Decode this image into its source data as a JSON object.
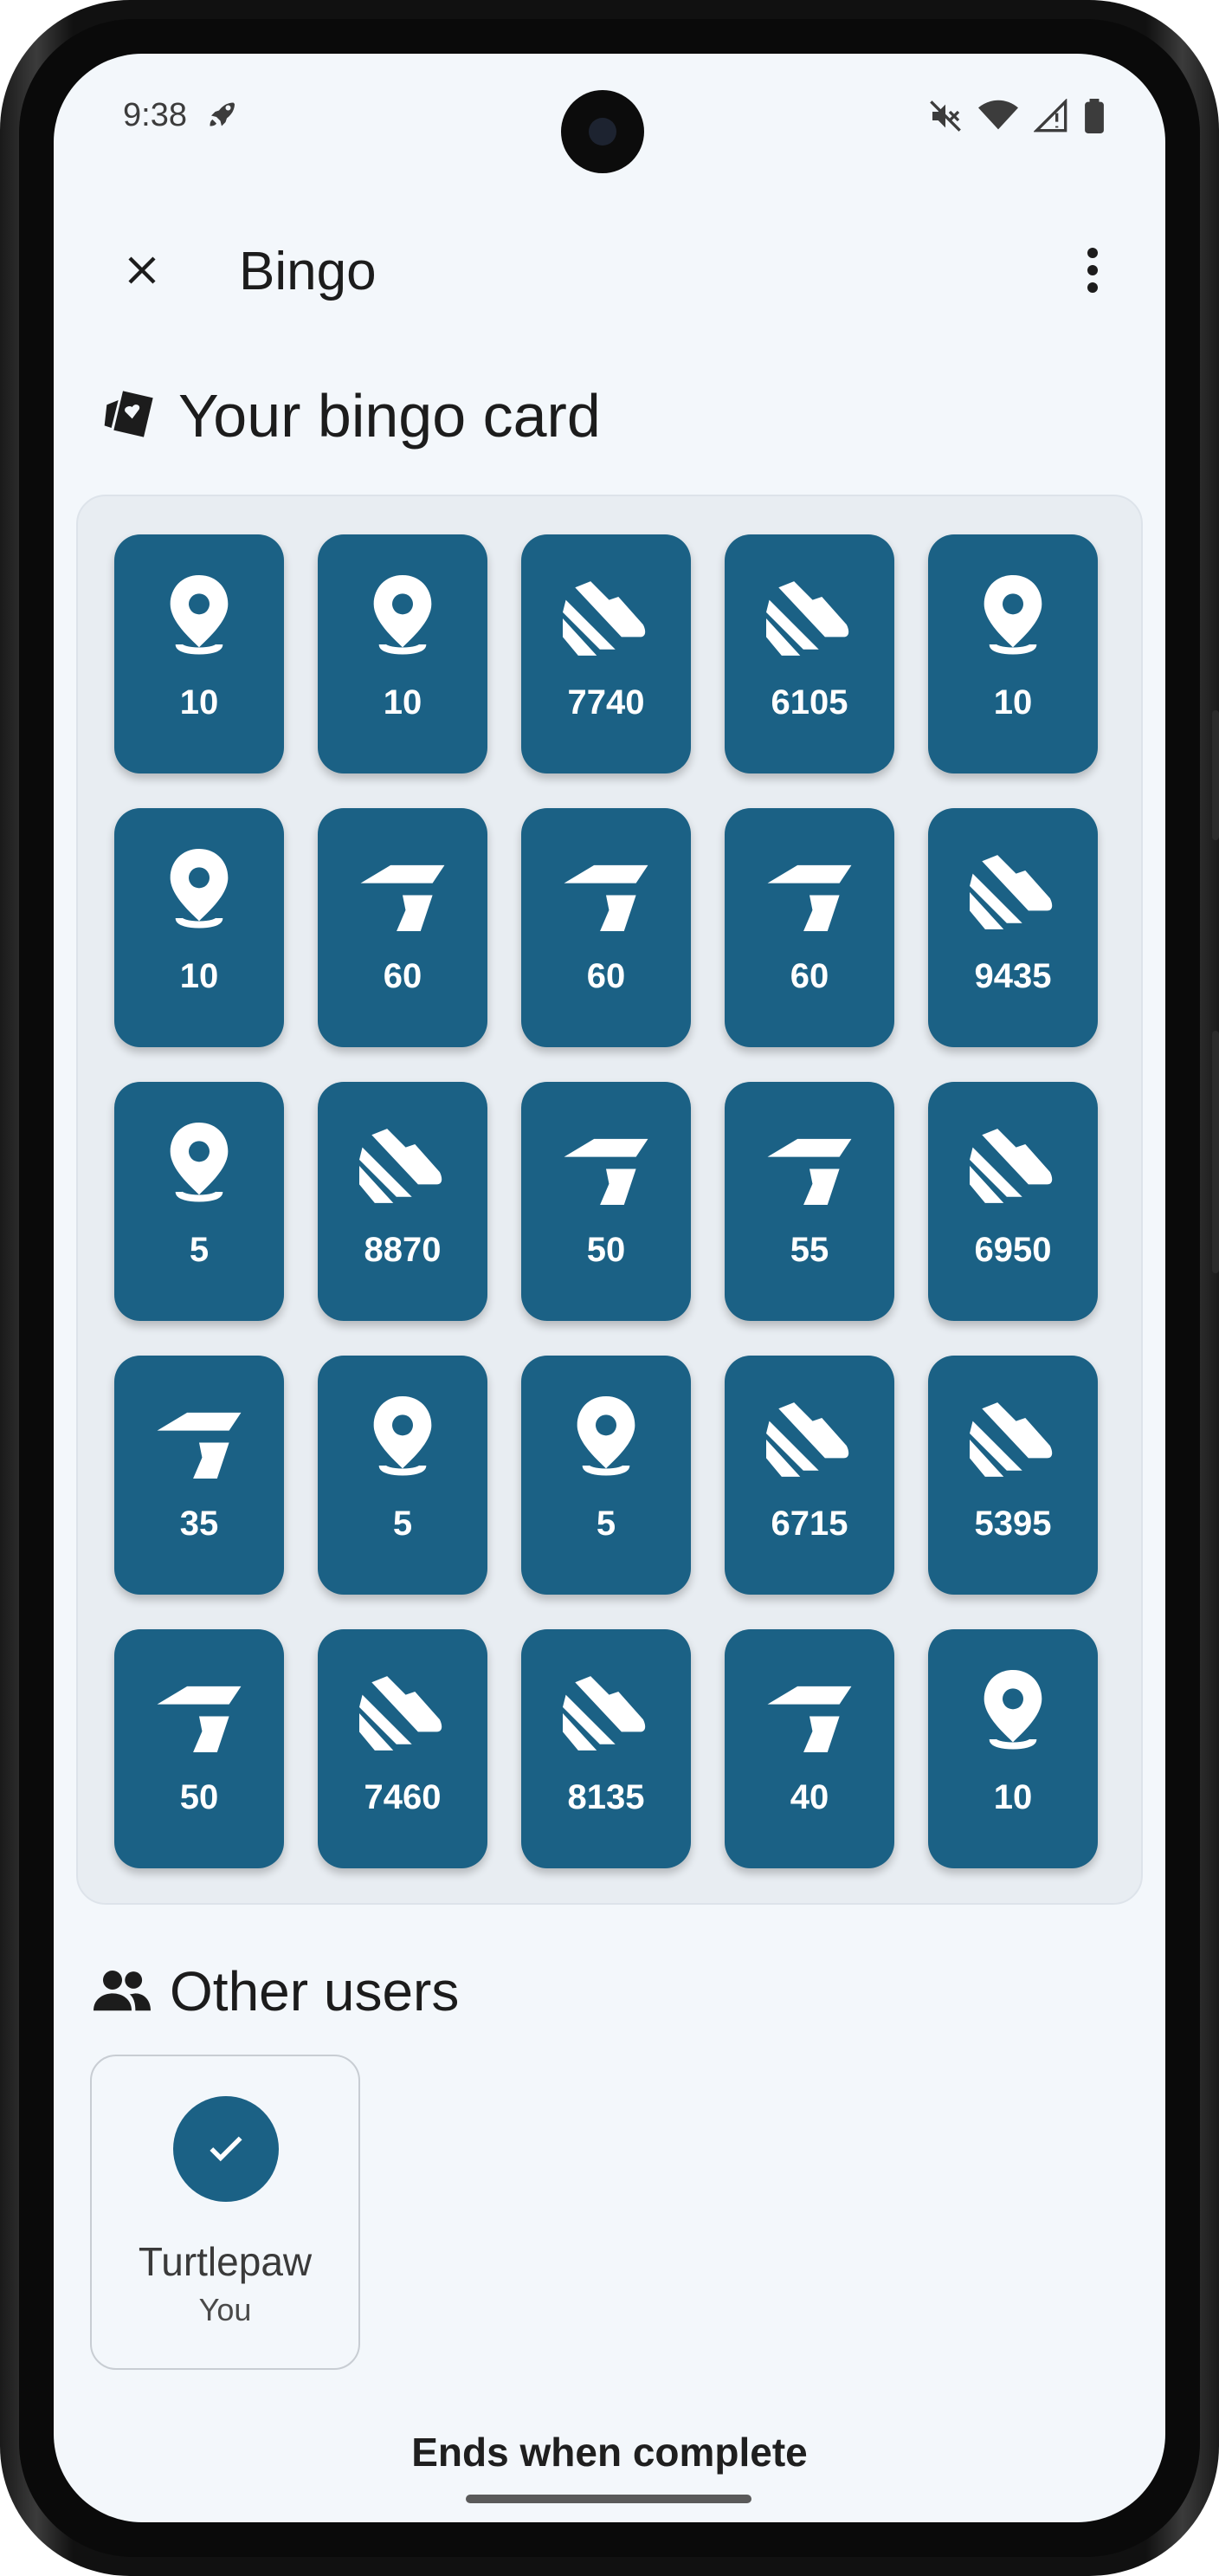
{
  "status": {
    "time": "9:38"
  },
  "appbar": {
    "title": "Bingo"
  },
  "card_section": {
    "title": "Your bingo card"
  },
  "tiles": [
    {
      "icon": "pin",
      "value": "10"
    },
    {
      "icon": "pin",
      "value": "10"
    },
    {
      "icon": "shoe",
      "value": "7740"
    },
    {
      "icon": "shoe",
      "value": "6105"
    },
    {
      "icon": "pin",
      "value": "10"
    },
    {
      "icon": "pin",
      "value": "10"
    },
    {
      "icon": "turn",
      "value": "60"
    },
    {
      "icon": "turn",
      "value": "60"
    },
    {
      "icon": "turn",
      "value": "60"
    },
    {
      "icon": "shoe",
      "value": "9435"
    },
    {
      "icon": "pin",
      "value": "5"
    },
    {
      "icon": "shoe",
      "value": "8870"
    },
    {
      "icon": "turn",
      "value": "50"
    },
    {
      "icon": "turn",
      "value": "55"
    },
    {
      "icon": "shoe",
      "value": "6950"
    },
    {
      "icon": "turn",
      "value": "35"
    },
    {
      "icon": "pin",
      "value": "5"
    },
    {
      "icon": "pin",
      "value": "5"
    },
    {
      "icon": "shoe",
      "value": "6715"
    },
    {
      "icon": "shoe",
      "value": "5395"
    },
    {
      "icon": "turn",
      "value": "50"
    },
    {
      "icon": "shoe",
      "value": "7460"
    },
    {
      "icon": "shoe",
      "value": "8135"
    },
    {
      "icon": "turn",
      "value": "40"
    },
    {
      "icon": "pin",
      "value": "10"
    }
  ],
  "users_section": {
    "title": "Other users"
  },
  "users": [
    {
      "name": "Turtlepaw",
      "subtitle": "You"
    }
  ],
  "footer": {
    "text": "Ends when complete"
  },
  "colors": {
    "tile": "#1b6185",
    "background": "#f3f7fb"
  }
}
